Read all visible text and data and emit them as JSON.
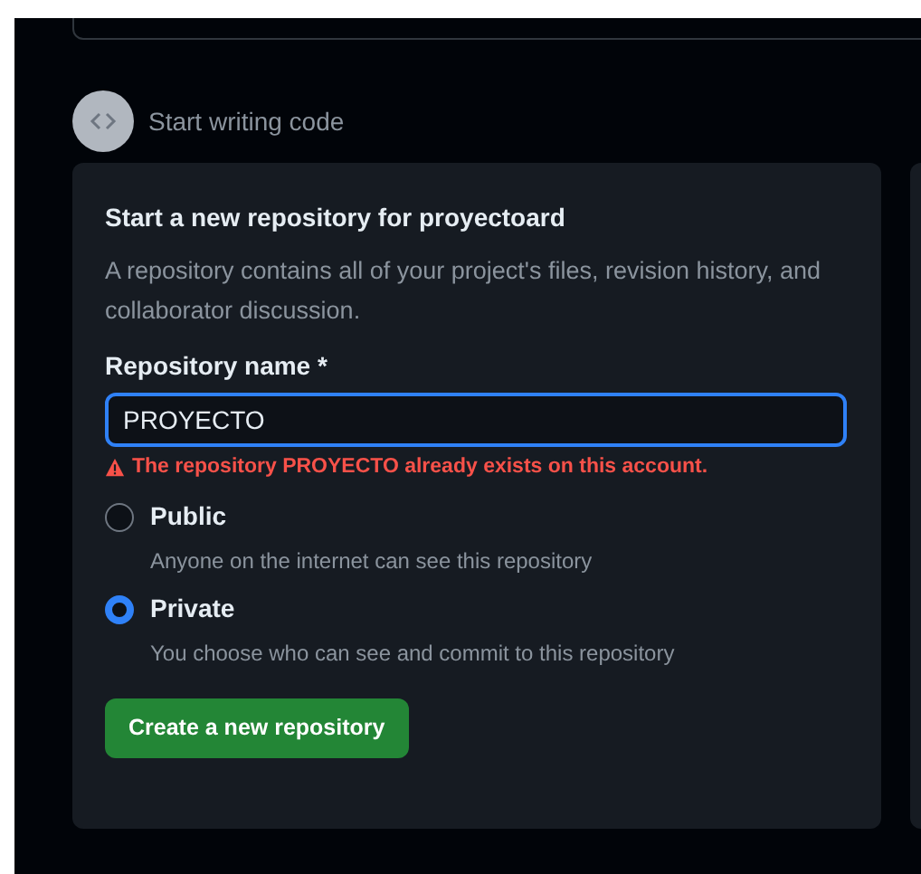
{
  "step": {
    "title": "Start writing code"
  },
  "card": {
    "title": "Start a new repository for proyectoard",
    "description": "A repository contains all of your project's files, revision history, and collaborator discussion.",
    "name_field": {
      "label": "Repository name *",
      "value": "PROYECTO",
      "error": "The repository PROYECTO already exists on this account."
    },
    "visibility": [
      {
        "label": "Public",
        "description": "Anyone on the internet can see this repository",
        "selected": false
      },
      {
        "label": "Private",
        "description": "You choose who can see and commit to this repository",
        "selected": true
      }
    ],
    "button": "Create a new repository"
  }
}
